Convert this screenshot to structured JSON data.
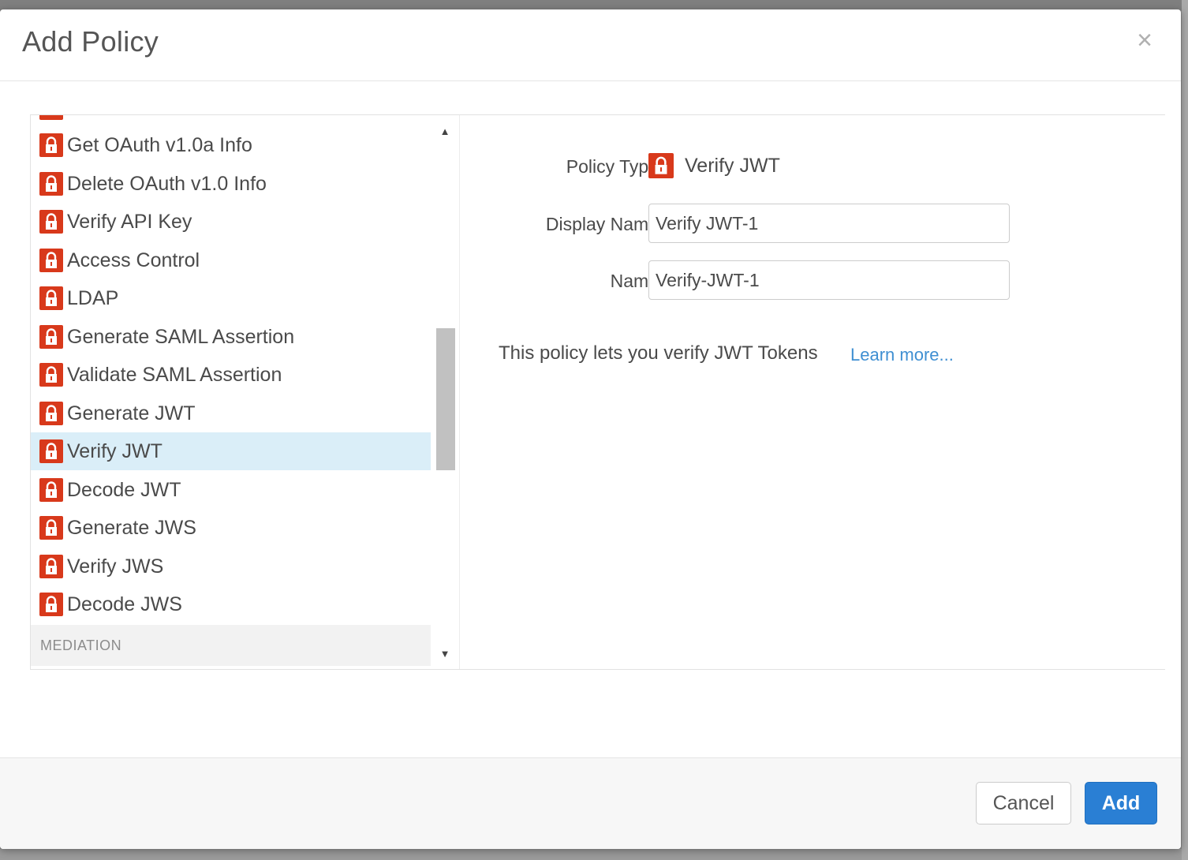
{
  "dialog": {
    "title": "Add Policy",
    "close_glyph": "×"
  },
  "policy_list": {
    "items": [
      {
        "label": "Get OAuth v1.0a Info",
        "icon": "lock-icon",
        "selected": false
      },
      {
        "label": "Delete OAuth v1.0 Info",
        "icon": "lock-icon",
        "selected": false
      },
      {
        "label": "Verify API Key",
        "icon": "lock-icon",
        "selected": false
      },
      {
        "label": "Access Control",
        "icon": "lock-icon",
        "selected": false
      },
      {
        "label": "LDAP",
        "icon": "lock-icon",
        "selected": false
      },
      {
        "label": "Generate SAML Assertion",
        "icon": "lock-icon",
        "selected": false
      },
      {
        "label": "Validate SAML Assertion",
        "icon": "lock-icon",
        "selected": false
      },
      {
        "label": "Generate JWT",
        "icon": "lock-icon",
        "selected": false
      },
      {
        "label": "Verify JWT",
        "icon": "lock-icon",
        "selected": true
      },
      {
        "label": "Decode JWT",
        "icon": "lock-icon",
        "selected": false
      },
      {
        "label": "Generate JWS",
        "icon": "lock-icon",
        "selected": false
      },
      {
        "label": "Verify JWS",
        "icon": "lock-icon",
        "selected": false
      },
      {
        "label": "Decode JWS",
        "icon": "lock-icon",
        "selected": false
      }
    ],
    "section_header": "MEDIATION"
  },
  "details": {
    "policy_type_label": "Policy Type",
    "policy_type_value": "Verify JWT",
    "display_name_label": "Display Name",
    "display_name_value": "Verify JWT-1",
    "name_label": "Name",
    "name_value": "Verify-JWT-1",
    "description": "This policy lets you verify JWT Tokens",
    "learn_more": "Learn more..."
  },
  "footer": {
    "cancel_label": "Cancel",
    "add_label": "Add"
  },
  "colors": {
    "lock_icon_bg": "#d8391b",
    "selected_row_bg": "#daeef8",
    "primary_button": "#2a7fd4",
    "link": "#3f8fd2"
  }
}
